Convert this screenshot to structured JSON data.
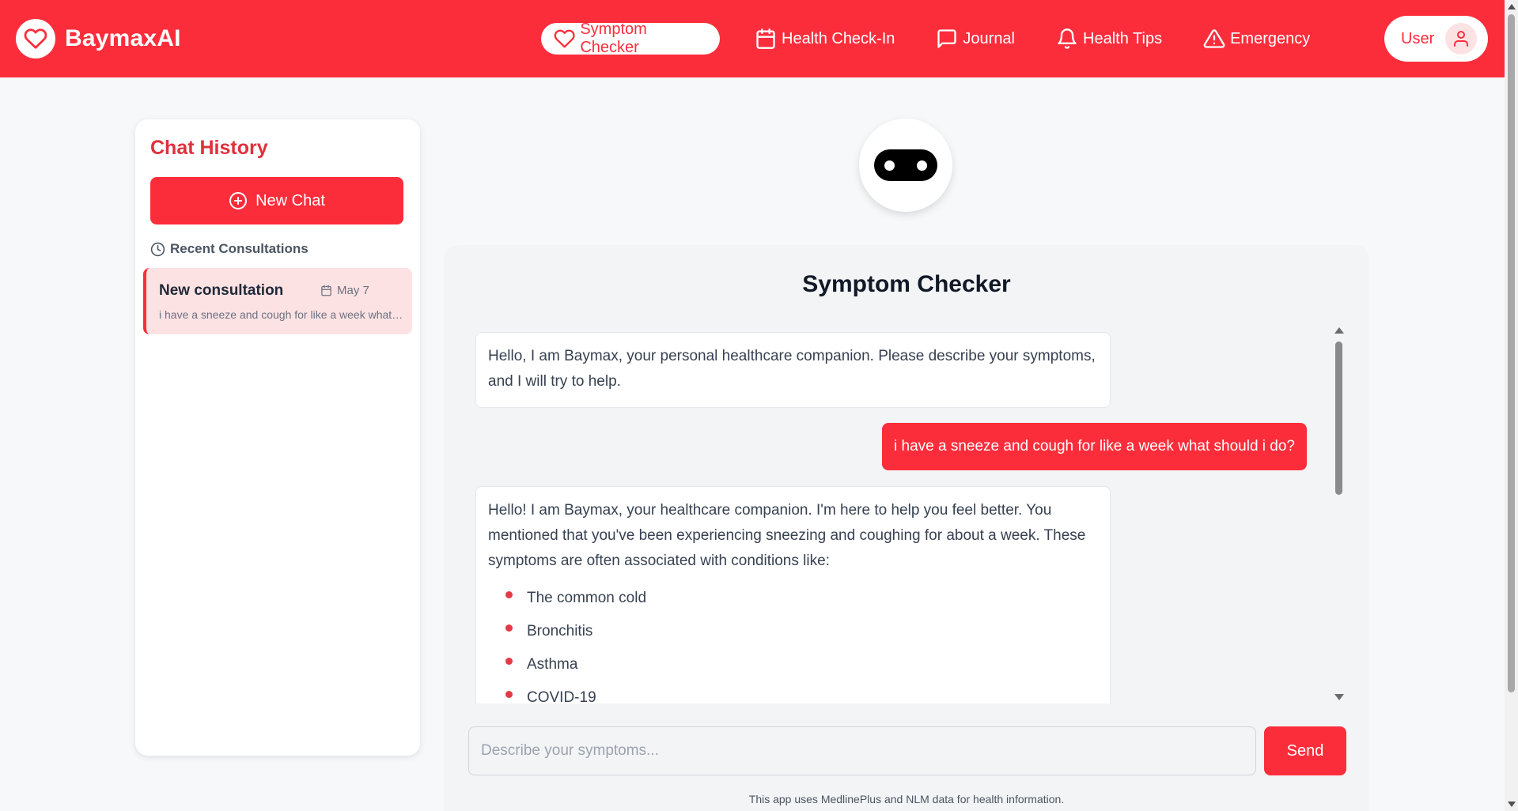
{
  "brand": {
    "name": "BaymaxAI"
  },
  "nav": {
    "items": [
      {
        "label": "Symptom Checker",
        "icon": "heart-icon",
        "active": true
      },
      {
        "label": "Health Check-In",
        "icon": "calendar-icon"
      },
      {
        "label": "Journal",
        "icon": "message-square-icon"
      },
      {
        "label": "Health Tips",
        "icon": "bell-icon"
      },
      {
        "label": "Emergency",
        "icon": "alert-triangle-icon"
      }
    ],
    "user_label": "User"
  },
  "sidebar": {
    "title": "Chat History",
    "new_chat_label": "New Chat",
    "recent_label": "Recent Consultations",
    "consultations": [
      {
        "title": "New consultation",
        "date": "May 7",
        "snippet": "i have a sneeze and cough for like a week what should i do?"
      }
    ]
  },
  "main": {
    "title": "Symptom Checker",
    "messages": {
      "bot_intro": "Hello, I am Baymax, your personal healthcare companion. Please describe your symptoms, and I will try to help.",
      "user_1": "i have a sneeze and cough for like a week what should i do?",
      "bot_reply": "Hello! I am Baymax, your healthcare companion. I'm here to help you feel better. You mentioned that you've been experiencing sneezing and coughing for about a week. These symptoms are often associated with conditions like:",
      "bot_reply_list": [
        "The common cold",
        "Bronchitis",
        "Asthma",
        "COVID-19"
      ]
    },
    "input": {
      "placeholder": "Describe your symptoms...",
      "value": ""
    },
    "send_label": "Send",
    "footnote": "This app uses MedlinePlus and NLM data for health information."
  },
  "colors": {
    "brand_red": "#fc2d3b",
    "active_consult_bg": "#fde2e4",
    "page_bg": "#f7f8fa"
  }
}
